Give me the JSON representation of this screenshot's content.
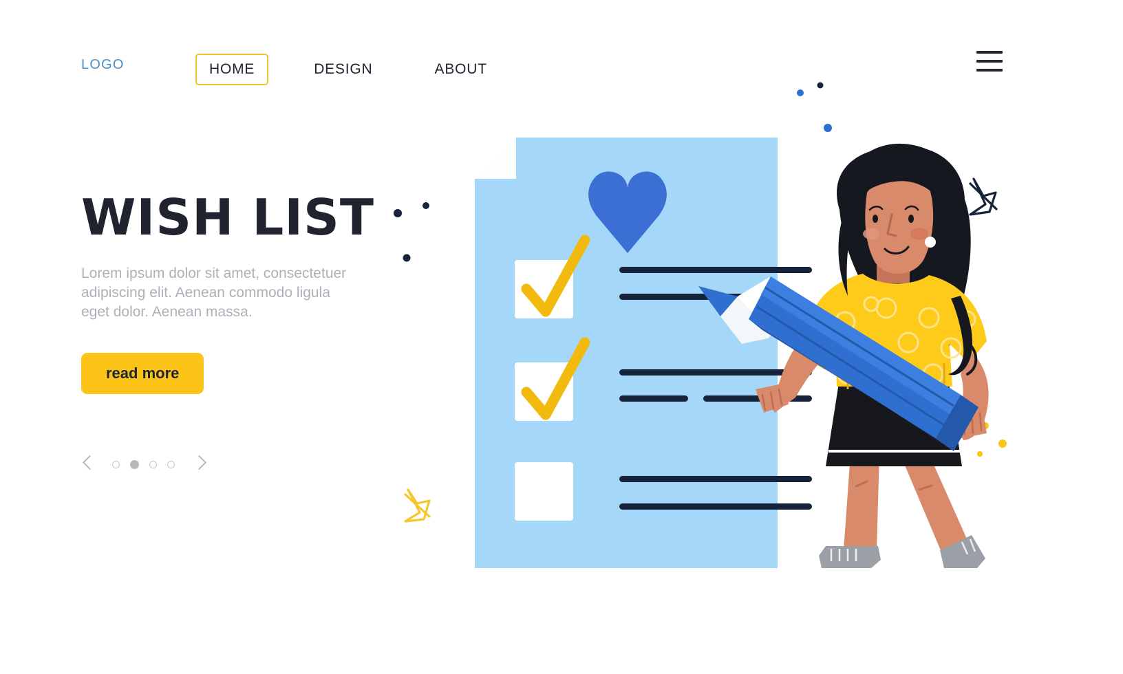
{
  "navbar": {
    "logo": "LOGO",
    "items": [
      {
        "label": "HOME",
        "active": true
      },
      {
        "label": "DESIGN",
        "active": false
      },
      {
        "label": "ABOUT",
        "active": false
      }
    ],
    "menu_icon": "hamburger-menu-icon"
  },
  "hero": {
    "title": "WISH LIST",
    "paragraph": "Lorem ipsum dolor sit amet, consectetuer adipiscing elit. Aenean commodo ligula eget dolor. Aenean massa.",
    "cta_label": "read more"
  },
  "carousel": {
    "prev_icon": "chevron-left-icon",
    "next_icon": "chevron-right-icon",
    "total_dots": 4,
    "active_index": 2
  },
  "illustration": {
    "name": "woman-with-pencil-and-checklist",
    "document": {
      "name": "checklist-paper",
      "folded_corner": true,
      "heart_icon": "heart-icon",
      "rows": [
        {
          "checked": true,
          "lines": 2,
          "split_second_line": false
        },
        {
          "checked": true,
          "lines": 2,
          "split_second_line": true
        },
        {
          "checked": false,
          "lines": 2,
          "split_second_line": false
        }
      ]
    },
    "character": {
      "name": "woman-character",
      "hair": "curly-dark-hair",
      "top": "yellow-patterned-tshirt",
      "skirt": "black-skirt",
      "shoes": "gray-sneakers"
    },
    "pencil": {
      "name": "blue-pencil"
    },
    "decorations": [
      "star-outline-dark",
      "star-outline-yellow",
      "dot-dark",
      "dot-yellow"
    ]
  },
  "colors": {
    "accent_yellow": "#fcc419",
    "brand_blue": "#4d8fc4",
    "paper_blue": "#a5d8f8",
    "heart_blue": "#3b6fd4",
    "pencil_blue": "#2f6fd0",
    "ink_navy": "#16233a",
    "text_dark": "#20242f",
    "text_muted": "#adb1b8",
    "skin": "#d98a6a",
    "hair_black": "#15181f",
    "skirt_black": "#16181d",
    "shoe_gray": "#9ba0a6"
  }
}
